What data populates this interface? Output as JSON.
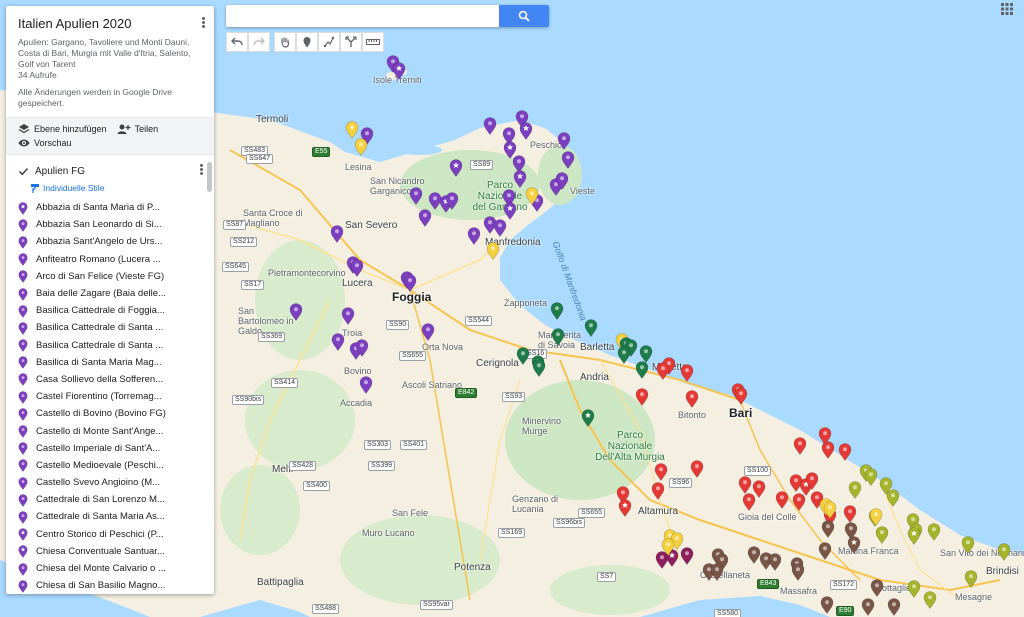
{
  "map": {
    "title": "Italien Apulien 2020",
    "description": "Apulien: Gargano, Tavoliere und Monti Dauni, Costa di Bari, Murgia mit Valle d'Itria, Salento, Golf von Tarent",
    "views": "34 Aufrufe",
    "saved_notice": "Alle Änderungen werden in Google Drive gespeichert.",
    "actions": {
      "add_layer": "Ebene hinzufügen",
      "share": "Teilen",
      "preview": "Vorschau"
    }
  },
  "layer": {
    "name": "Apulien FG",
    "styles_label": "Individuelle Stile",
    "color": "#7b3fbf",
    "items": [
      {
        "label": "Abbazia di Santa Maria di P...",
        "icon": "star-pin-icon"
      },
      {
        "label": "Abbazia San Leonardo di Si...",
        "icon": "pin-icon"
      },
      {
        "label": "Abbazia Sant'Angelo de Urs...",
        "icon": "pin-icon"
      },
      {
        "label": "Anfiteatro Romano (Lucera ...",
        "icon": "pin-icon"
      },
      {
        "label": "Arco di San Felice (Vieste FG)",
        "icon": "pin-icon"
      },
      {
        "label": "Baia delle Zagare (Baia delle...",
        "icon": "pin-icon"
      },
      {
        "label": "Basilica Cattedrale di Foggia...",
        "icon": "pin-icon"
      },
      {
        "label": "Basilica Cattedrale di Santa ...",
        "icon": "pin-icon"
      },
      {
        "label": "Basilica Cattedrale di Santa ...",
        "icon": "pin-icon"
      },
      {
        "label": "Basilica di Santa Maria Mag...",
        "icon": "pin-icon"
      },
      {
        "label": "Casa Sollievo della Sofferen...",
        "icon": "pin-icon"
      },
      {
        "label": "Castel Fiorentino (Torremag...",
        "icon": "pin-icon"
      },
      {
        "label": "Castello di Bovino (Bovino FG)",
        "icon": "pin-icon"
      },
      {
        "label": "Castello di Monte Sant'Ange...",
        "icon": "pin-icon"
      },
      {
        "label": "Castello Imperiale di Sant'A...",
        "icon": "pin-icon"
      },
      {
        "label": "Castello Medioevale (Peschi...",
        "icon": "pin-icon"
      },
      {
        "label": "Castello Svevo Angioino (M...",
        "icon": "pin-icon"
      },
      {
        "label": "Cattedrale di San Lorenzo M...",
        "icon": "pin-icon"
      },
      {
        "label": "Cattedrale di Santa Maria As...",
        "icon": "pin-icon"
      },
      {
        "label": "Centro Storico di Peschici (P...",
        "icon": "star-pin-icon"
      },
      {
        "label": "Chiesa Conventuale Santuar...",
        "icon": "star-pin-icon"
      },
      {
        "label": "Chiesa del Monte Calvario o ...",
        "icon": "pin-icon"
      },
      {
        "label": "Chiesa di San Basilio Magno...",
        "icon": "pin-icon"
      }
    ]
  },
  "search": {
    "placeholder": "",
    "value": ""
  },
  "places": [
    {
      "name": "Isole Tremiti",
      "cls": "place"
    },
    {
      "name": "Termoli",
      "cls": "place city"
    },
    {
      "name": "Lesina",
      "cls": "place"
    },
    {
      "name": "San Nicandro Garganico",
      "cls": "place"
    },
    {
      "name": "Parco Nazionale del Gargano",
      "cls": "place park"
    },
    {
      "name": "Peschici",
      "cls": "place"
    },
    {
      "name": "Vieste",
      "cls": "place"
    },
    {
      "name": "Santa Croce di Magliano",
      "cls": "place"
    },
    {
      "name": "San Severo",
      "cls": "place city"
    },
    {
      "name": "Manfredonia",
      "cls": "place city"
    },
    {
      "name": "Golfo di Manfredonia",
      "cls": "place sea"
    },
    {
      "name": "Pietramontecorvino",
      "cls": "place"
    },
    {
      "name": "Lucera",
      "cls": "place city"
    },
    {
      "name": "Foggia",
      "cls": "place big"
    },
    {
      "name": "Zapponeta",
      "cls": "place"
    },
    {
      "name": "San Bartolomeo in Galdo",
      "cls": "place"
    },
    {
      "name": "Troia",
      "cls": "place"
    },
    {
      "name": "Orta Nova",
      "cls": "place"
    },
    {
      "name": "Margherita di Savoia",
      "cls": "place"
    },
    {
      "name": "Barletta",
      "cls": "place city"
    },
    {
      "name": "Bovino",
      "cls": "place"
    },
    {
      "name": "Cerignola",
      "cls": "place city"
    },
    {
      "name": "Molfetta",
      "cls": "place city"
    },
    {
      "name": "Andria",
      "cls": "place city"
    },
    {
      "name": "Ascoli Satriano",
      "cls": "place"
    },
    {
      "name": "Accadia",
      "cls": "place"
    },
    {
      "name": "Bari",
      "cls": "place big"
    },
    {
      "name": "Bitonto",
      "cls": "place"
    },
    {
      "name": "Minervino Murge",
      "cls": "place"
    },
    {
      "name": "Parco Nazionale Dell'Alta Murgia",
      "cls": "place park"
    },
    {
      "name": "Melfi",
      "cls": "place city"
    },
    {
      "name": "Altamura",
      "cls": "place city"
    },
    {
      "name": "Gioia del Colle",
      "cls": "place"
    },
    {
      "name": "Genzano di Lucania",
      "cls": "place"
    },
    {
      "name": "San Fele",
      "cls": "place"
    },
    {
      "name": "Muro Lucano",
      "cls": "place"
    },
    {
      "name": "Potenza",
      "cls": "place city"
    },
    {
      "name": "Battipaglia",
      "cls": "place city"
    },
    {
      "name": "Martina Franca",
      "cls": "place"
    },
    {
      "name": "Grottaglie",
      "cls": "place"
    },
    {
      "name": "San Vito dei Normanni",
      "cls": "place"
    },
    {
      "name": "Brindisi",
      "cls": "place city"
    },
    {
      "name": "Mesagne",
      "cls": "place"
    },
    {
      "name": "Massafra",
      "cls": "place"
    },
    {
      "name": "Castellaneta",
      "cls": "place"
    }
  ],
  "roads": [
    "SS483",
    "SS647",
    "E55",
    "SS89",
    "SS87",
    "SS212",
    "SS645",
    "SS17",
    "SS90",
    "SS544",
    "SS655",
    "SS369",
    "SS16",
    "SS414",
    "SS90bis",
    "SS93",
    "E842",
    "SS303",
    "SS401",
    "SS428",
    "SS400",
    "SS399",
    "SS96",
    "SS655",
    "SS169",
    "SS96bis",
    "SS100",
    "E843",
    "SS172",
    "SS7",
    "SS488",
    "SS95var",
    "SS580",
    "E90"
  ],
  "colors": {
    "gargano": "#7b3fbf",
    "foggia": "#7b3fbf",
    "bat": "#1e7b4a",
    "bari": "#e53935",
    "itria": "#a4b52c",
    "taranto": "#795548",
    "yellow": "#f4d03f",
    "magenta": "#8e1f5e"
  }
}
